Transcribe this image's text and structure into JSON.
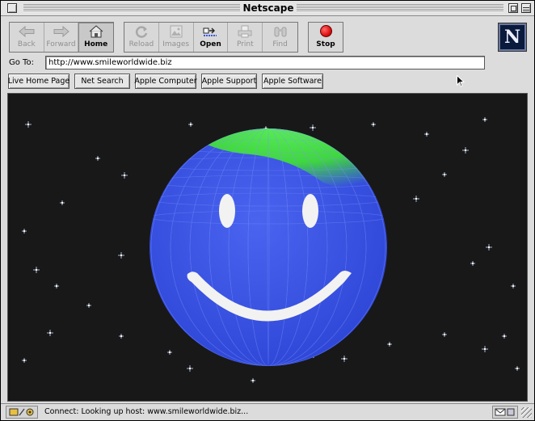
{
  "window": {
    "title": "Netscape"
  },
  "toolbar": {
    "buttons": [
      {
        "label": "Back",
        "icon": "back-arrow-icon",
        "enabled": false
      },
      {
        "label": "Forward",
        "icon": "forward-arrow-icon",
        "enabled": false
      },
      {
        "label": "Home",
        "icon": "home-icon",
        "enabled": true
      },
      {
        "label": "Reload",
        "icon": "reload-icon",
        "enabled": false
      },
      {
        "label": "Images",
        "icon": "images-icon",
        "enabled": false
      },
      {
        "label": "Open",
        "icon": "open-icon",
        "enabled": true
      },
      {
        "label": "Print",
        "icon": "print-icon",
        "enabled": false
      },
      {
        "label": "Find",
        "icon": "find-icon",
        "enabled": false
      }
    ],
    "stop_label": "Stop",
    "logo_letter": "N"
  },
  "location": {
    "label": "Go To:",
    "value": "http://www.smileworldwide.biz"
  },
  "personal_toolbar": [
    "Live Home Page",
    "Net Search",
    "Apple Computer",
    "Apple Support",
    "Apple Software"
  ],
  "content": {
    "background_color": "#181818",
    "globe_color": "#3a56e8",
    "land_color": "#3fd63f",
    "smile_color": "#f2f2f2"
  },
  "statusbar": {
    "status_text": "Connect: Looking up host: www.smileworldwide.biz..."
  }
}
